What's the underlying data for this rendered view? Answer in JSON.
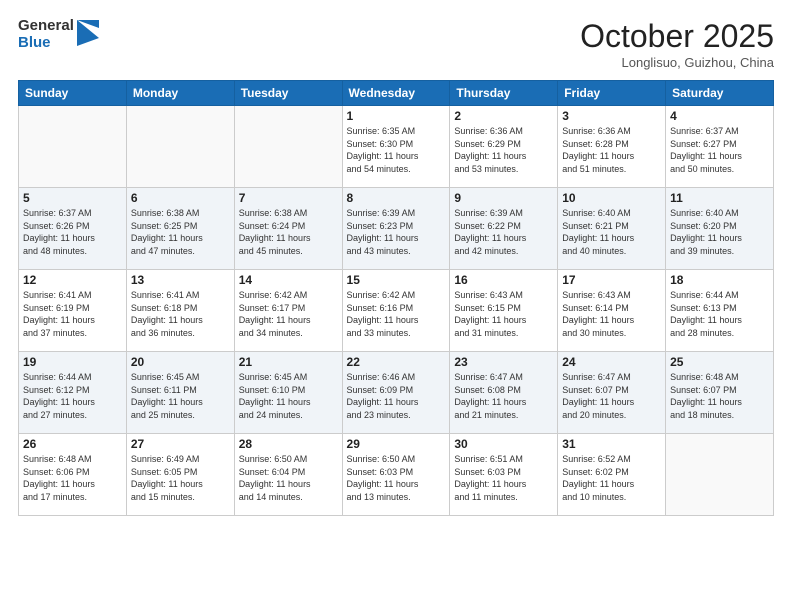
{
  "header": {
    "logo_line1": "General",
    "logo_line2": "Blue",
    "month": "October 2025",
    "location": "Longlisuo, Guizhou, China"
  },
  "weekdays": [
    "Sunday",
    "Monday",
    "Tuesday",
    "Wednesday",
    "Thursday",
    "Friday",
    "Saturday"
  ],
  "weeks": [
    [
      {
        "day": "",
        "info": ""
      },
      {
        "day": "",
        "info": ""
      },
      {
        "day": "",
        "info": ""
      },
      {
        "day": "1",
        "info": "Sunrise: 6:35 AM\nSunset: 6:30 PM\nDaylight: 11 hours\nand 54 minutes."
      },
      {
        "day": "2",
        "info": "Sunrise: 6:36 AM\nSunset: 6:29 PM\nDaylight: 11 hours\nand 53 minutes."
      },
      {
        "day": "3",
        "info": "Sunrise: 6:36 AM\nSunset: 6:28 PM\nDaylight: 11 hours\nand 51 minutes."
      },
      {
        "day": "4",
        "info": "Sunrise: 6:37 AM\nSunset: 6:27 PM\nDaylight: 11 hours\nand 50 minutes."
      }
    ],
    [
      {
        "day": "5",
        "info": "Sunrise: 6:37 AM\nSunset: 6:26 PM\nDaylight: 11 hours\nand 48 minutes."
      },
      {
        "day": "6",
        "info": "Sunrise: 6:38 AM\nSunset: 6:25 PM\nDaylight: 11 hours\nand 47 minutes."
      },
      {
        "day": "7",
        "info": "Sunrise: 6:38 AM\nSunset: 6:24 PM\nDaylight: 11 hours\nand 45 minutes."
      },
      {
        "day": "8",
        "info": "Sunrise: 6:39 AM\nSunset: 6:23 PM\nDaylight: 11 hours\nand 43 minutes."
      },
      {
        "day": "9",
        "info": "Sunrise: 6:39 AM\nSunset: 6:22 PM\nDaylight: 11 hours\nand 42 minutes."
      },
      {
        "day": "10",
        "info": "Sunrise: 6:40 AM\nSunset: 6:21 PM\nDaylight: 11 hours\nand 40 minutes."
      },
      {
        "day": "11",
        "info": "Sunrise: 6:40 AM\nSunset: 6:20 PM\nDaylight: 11 hours\nand 39 minutes."
      }
    ],
    [
      {
        "day": "12",
        "info": "Sunrise: 6:41 AM\nSunset: 6:19 PM\nDaylight: 11 hours\nand 37 minutes."
      },
      {
        "day": "13",
        "info": "Sunrise: 6:41 AM\nSunset: 6:18 PM\nDaylight: 11 hours\nand 36 minutes."
      },
      {
        "day": "14",
        "info": "Sunrise: 6:42 AM\nSunset: 6:17 PM\nDaylight: 11 hours\nand 34 minutes."
      },
      {
        "day": "15",
        "info": "Sunrise: 6:42 AM\nSunset: 6:16 PM\nDaylight: 11 hours\nand 33 minutes."
      },
      {
        "day": "16",
        "info": "Sunrise: 6:43 AM\nSunset: 6:15 PM\nDaylight: 11 hours\nand 31 minutes."
      },
      {
        "day": "17",
        "info": "Sunrise: 6:43 AM\nSunset: 6:14 PM\nDaylight: 11 hours\nand 30 minutes."
      },
      {
        "day": "18",
        "info": "Sunrise: 6:44 AM\nSunset: 6:13 PM\nDaylight: 11 hours\nand 28 minutes."
      }
    ],
    [
      {
        "day": "19",
        "info": "Sunrise: 6:44 AM\nSunset: 6:12 PM\nDaylight: 11 hours\nand 27 minutes."
      },
      {
        "day": "20",
        "info": "Sunrise: 6:45 AM\nSunset: 6:11 PM\nDaylight: 11 hours\nand 25 minutes."
      },
      {
        "day": "21",
        "info": "Sunrise: 6:45 AM\nSunset: 6:10 PM\nDaylight: 11 hours\nand 24 minutes."
      },
      {
        "day": "22",
        "info": "Sunrise: 6:46 AM\nSunset: 6:09 PM\nDaylight: 11 hours\nand 23 minutes."
      },
      {
        "day": "23",
        "info": "Sunrise: 6:47 AM\nSunset: 6:08 PM\nDaylight: 11 hours\nand 21 minutes."
      },
      {
        "day": "24",
        "info": "Sunrise: 6:47 AM\nSunset: 6:07 PM\nDaylight: 11 hours\nand 20 minutes."
      },
      {
        "day": "25",
        "info": "Sunrise: 6:48 AM\nSunset: 6:07 PM\nDaylight: 11 hours\nand 18 minutes."
      }
    ],
    [
      {
        "day": "26",
        "info": "Sunrise: 6:48 AM\nSunset: 6:06 PM\nDaylight: 11 hours\nand 17 minutes."
      },
      {
        "day": "27",
        "info": "Sunrise: 6:49 AM\nSunset: 6:05 PM\nDaylight: 11 hours\nand 15 minutes."
      },
      {
        "day": "28",
        "info": "Sunrise: 6:50 AM\nSunset: 6:04 PM\nDaylight: 11 hours\nand 14 minutes."
      },
      {
        "day": "29",
        "info": "Sunrise: 6:50 AM\nSunset: 6:03 PM\nDaylight: 11 hours\nand 13 minutes."
      },
      {
        "day": "30",
        "info": "Sunrise: 6:51 AM\nSunset: 6:03 PM\nDaylight: 11 hours\nand 11 minutes."
      },
      {
        "day": "31",
        "info": "Sunrise: 6:52 AM\nSunset: 6:02 PM\nDaylight: 11 hours\nand 10 minutes."
      },
      {
        "day": "",
        "info": ""
      }
    ]
  ]
}
